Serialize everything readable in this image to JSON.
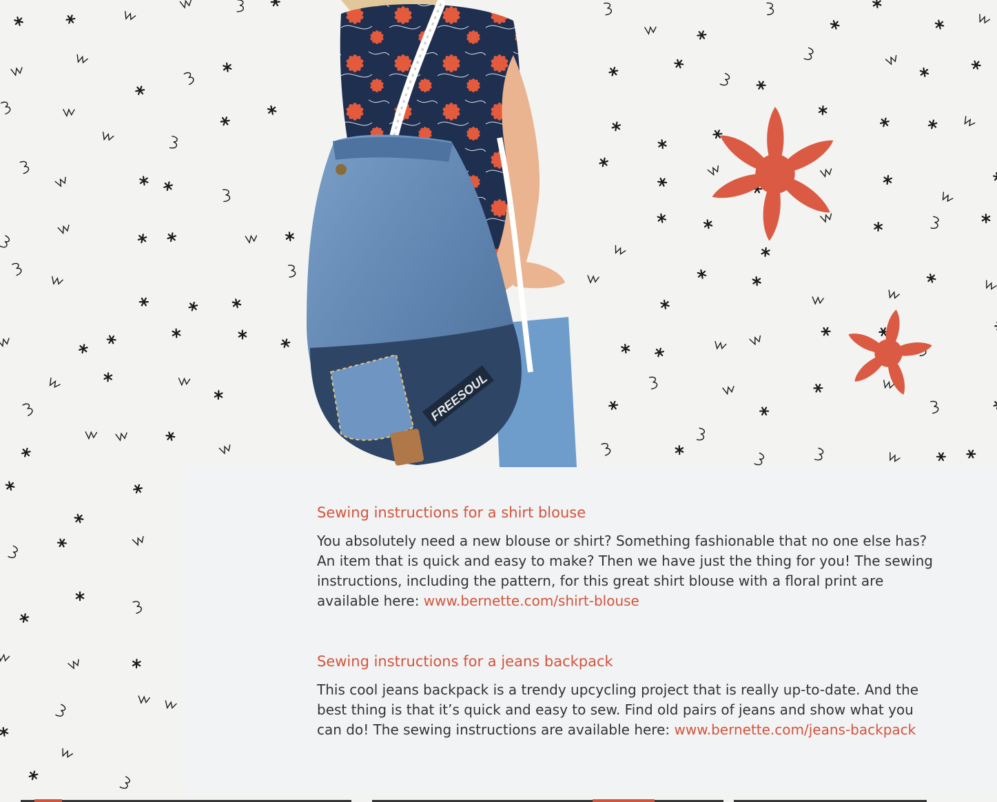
{
  "sections": [
    {
      "title": "Sewing instructions for a shirt blouse",
      "body": "You absolutely need a new blouse or shirt? Something fashionable that no one else has? An item that is quick and easy to make? Then we have just the thing for you! The sewing instructions, including the pattern, for this great shirt blouse with a floral print are available here: ",
      "link_text": "www.bernette.com/shirt-blouse"
    },
    {
      "title": "Sewing instructions for a jeans backpack",
      "body": "This cool jeans backpack is a trendy upcycling project that is really up-to-date. And the best thing is that it’s quick and easy to sew. Find old pairs of jeans and show what you can do! The sewing instructions are available here: ",
      "link_text": "www.bernette.com/jeans-backpack"
    }
  ],
  "photo": {
    "brand_label": "FREESOUL"
  },
  "colors": {
    "accent": "#d2543c",
    "flower": "#db5a43",
    "background": "#f3f3f2",
    "panel": "#f2f3f4",
    "denim": "#5f85b0",
    "blouse": "#1f2f4f"
  }
}
